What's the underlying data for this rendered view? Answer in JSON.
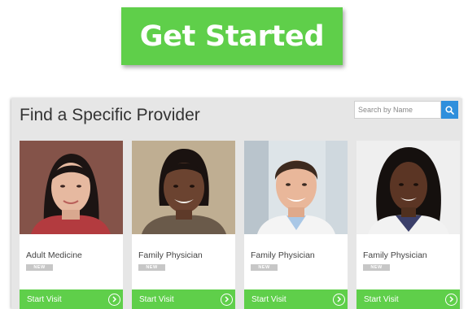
{
  "cta": {
    "label": "Get Started"
  },
  "provider_panel": {
    "title": "Find a Specific Provider",
    "search": {
      "placeholder": "Search by Name",
      "icon": "search-icon"
    }
  },
  "providers": [
    {
      "specialty": "Adult Medicine",
      "badge": "NEW",
      "action": "Start Visit"
    },
    {
      "specialty": "Family Physician",
      "badge": "NEW",
      "action": "Start Visit"
    },
    {
      "specialty": "Family Physician",
      "badge": "NEW",
      "action": "Start Visit"
    },
    {
      "specialty": "Family Physician",
      "badge": "NEW",
      "action": "Start Visit"
    }
  ],
  "colors": {
    "accent_green": "#5fcf4a",
    "search_blue": "#2f8fdc",
    "panel_gray": "#e6e6e6"
  }
}
